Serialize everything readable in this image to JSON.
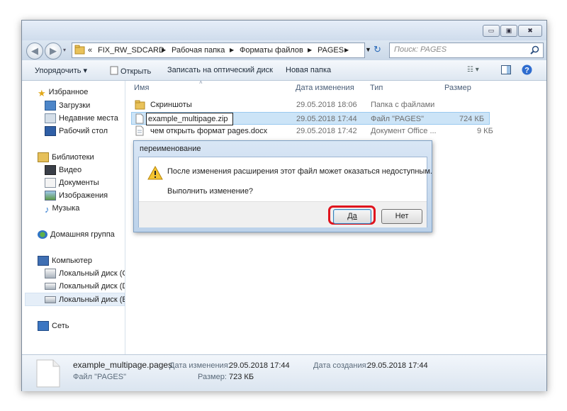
{
  "window": {
    "controls": {
      "minimize": "▭",
      "maximize": "▣",
      "close": "✖"
    }
  },
  "address": {
    "overflow": "«",
    "crumbs": [
      "FIX_RW_SDCARD",
      "Рабочая папка",
      "Форматы файлов",
      "PAGES"
    ],
    "search_placeholder": "Поиск: PAGES"
  },
  "toolbar": {
    "organize": "Упорядочить",
    "open": "Открыть",
    "burn": "Записать на оптический диск",
    "new_folder": "Новая папка"
  },
  "sidebar": {
    "favorites": "Избранное",
    "fav_items": [
      "Загрузки",
      "Недавние места",
      "Рабочий стол"
    ],
    "libraries": "Библиотеки",
    "lib_items": [
      "Видео",
      "Документы",
      "Изображения",
      "Музыка"
    ],
    "homegroup": "Домашняя группа",
    "computer": "Компьютер",
    "drives": [
      "Локальный диск (С",
      "Локальный диск (D",
      "Локальный диск (E:"
    ],
    "network": "Сеть"
  },
  "columns": {
    "name": "Имя",
    "date": "Дата изменения",
    "type": "Тип",
    "size": "Размер"
  },
  "files": [
    {
      "name": "Скриншоты",
      "date": "29.05.2018 18:06",
      "type": "Папка с файлами",
      "size": ""
    },
    {
      "name": "example_multipage.zip",
      "date": "29.05.2018 17:44",
      "type": "Файл \"PAGES\"",
      "size": "724 КБ"
    },
    {
      "name": "чем открыть формат pages.docx",
      "date": "29.05.2018 17:42",
      "type": "Документ Office ...",
      "size": "9 КБ"
    }
  ],
  "dialog": {
    "title": "переименование",
    "message": "После изменения расширения этот файл может оказаться недоступным.",
    "question": "Выполнить изменение?",
    "yes": "Да",
    "no": "Нет"
  },
  "status": {
    "filename": "example_multipage.pages",
    "filetype": "Файл \"PAGES\"",
    "modified_label": "Дата изменения:",
    "modified_value": "29.05.2018 17:44",
    "created_label": "Дата создания:",
    "created_value": "29.05.2018 17:44",
    "size_label": "Размер:",
    "size_value": "723 КБ"
  },
  "colors": {
    "highlight_ring": "#e0141e",
    "selection": "#cce4f7",
    "link_text": "#1e2b3a"
  }
}
